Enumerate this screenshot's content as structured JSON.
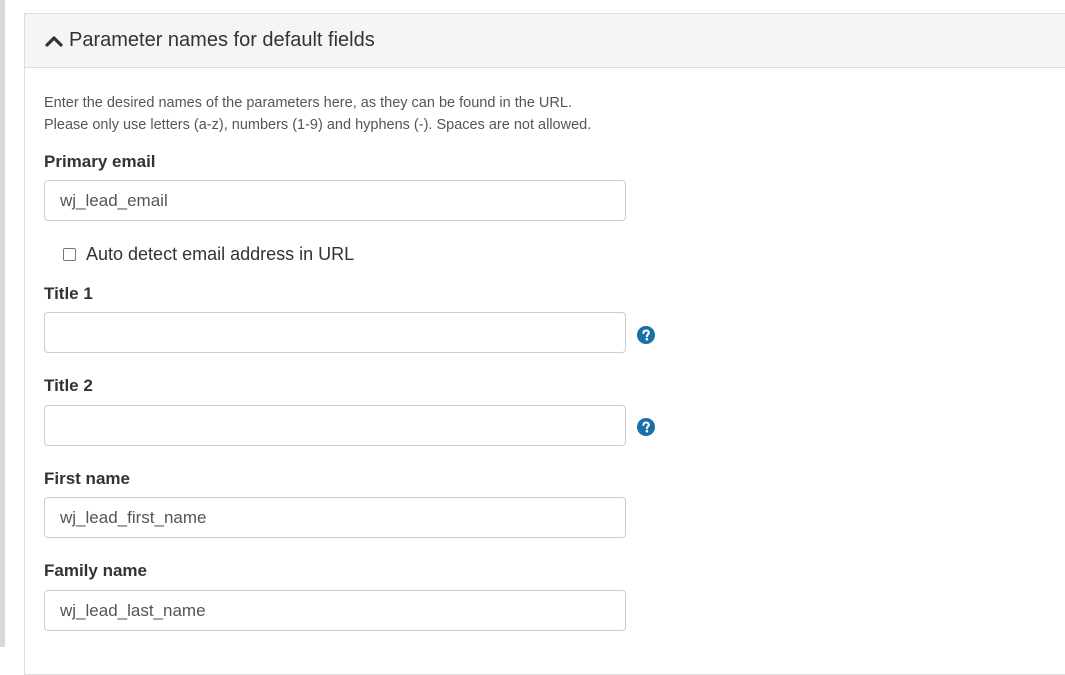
{
  "panel": {
    "title": "Parameter names for default fields",
    "expanded": true,
    "chevron_icon": "chevron-up-icon"
  },
  "help": {
    "line1": "Enter the desired names of the parameters here, as they can be found in the URL.",
    "line2": "Please only use letters (a-z), numbers (1-9) and hyphens (-). Spaces are not allowed."
  },
  "fields": {
    "primary_email": {
      "label": "Primary email",
      "value": "wj_lead_email"
    },
    "auto_detect": {
      "label": "Auto detect email address in URL",
      "checked": false
    },
    "title1": {
      "label": "Title 1",
      "value": "",
      "help_icon": "question-circle-icon"
    },
    "title2": {
      "label": "Title 2",
      "value": "",
      "help_icon": "question-circle-icon"
    },
    "first_name": {
      "label": "First name",
      "value": "wj_lead_first_name"
    },
    "family_name": {
      "label": "Family name",
      "value": "wj_lead_last_name"
    }
  },
  "colors": {
    "accent": "#1a6fa8",
    "heading_bg": "#f5f5f5",
    "border": "#dddddd"
  }
}
